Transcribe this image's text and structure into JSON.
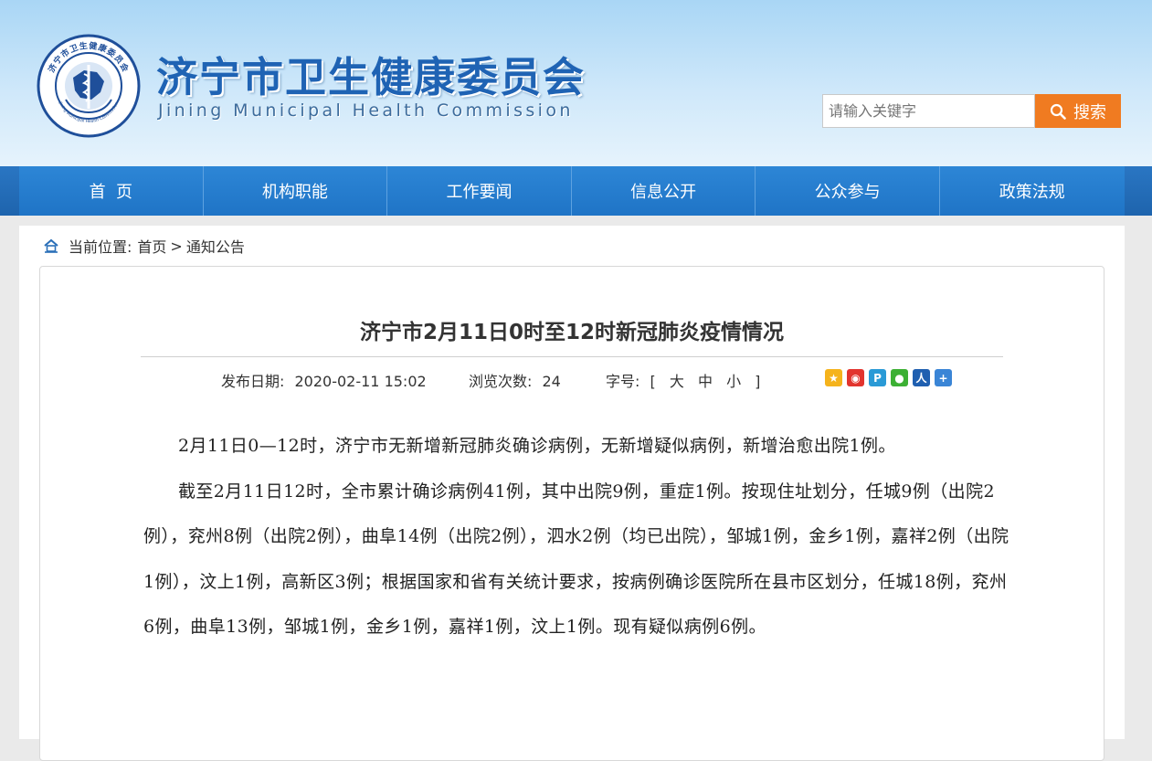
{
  "header": {
    "title": "济宁市卫生健康委员会",
    "subtitle": "Jining Municipal Health Commission",
    "emblem_top_text": "济宁市卫生健康委员会",
    "emblem_bottom_text": "Jining Municipal Health Commission",
    "colors": {
      "title": "#1f63b4",
      "nav": "#1f74c6",
      "search_button": "#f07b21"
    }
  },
  "search": {
    "placeholder": "请输入关键字",
    "button_label": "搜索"
  },
  "nav": {
    "items": [
      {
        "label": "首  页"
      },
      {
        "label": "机构职能"
      },
      {
        "label": "工作要闻"
      },
      {
        "label": "信息公开"
      },
      {
        "label": "公众参与"
      },
      {
        "label": "政策法规"
      }
    ]
  },
  "breadcrumb": {
    "prefix": "当前位置:",
    "home": "首页",
    "separator": ">",
    "current": "通知公告"
  },
  "article": {
    "title": "济宁市2月11日0时至12时新冠肺炎疫情情况",
    "publish_label": "发布日期:",
    "publish_date": "2020-02-11 15:02",
    "views_label": "浏览次数:",
    "views": "24",
    "font_label": "字号:",
    "font_bracket_open": "[",
    "font_large": "大",
    "font_medium": "中",
    "font_small": "小",
    "font_bracket_close": "]",
    "share_icons": [
      "qzone-icon",
      "weibo-icon",
      "tencent-weibo-icon",
      "wechat-icon",
      "renren-icon",
      "more-share-icon"
    ],
    "paragraphs": [
      "2月11日0—12时，济宁市无新增新冠肺炎确诊病例，无新增疑似病例，新增治愈出院1例。",
      "截至2月11日12时，全市累计确诊病例41例，其中出院9例，重症1例。按现住址划分，任城9例（出院2例），兖州8例（出院2例），曲阜14例（出院2例），泗水2例（均已出院），邹城1例，金乡1例，嘉祥2例（出院1例），汶上1例，高新区3例；根据国家和省有关统计要求，按病例确诊医院所在县市区划分，任城18例，兖州6例，曲阜13例，邹城1例，金乡1例，嘉祥1例，汶上1例。现有疑似病例6例。"
    ]
  }
}
